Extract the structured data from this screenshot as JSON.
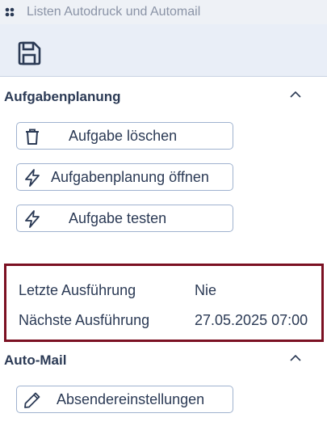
{
  "window": {
    "title": "Listen Autodruck und Automail"
  },
  "toolbar": {
    "save_icon": "floppy-disk-icon"
  },
  "task_planning": {
    "title": "Aufgabenplanung",
    "buttons": [
      {
        "label": "Aufgabe löschen",
        "icon": "trash-icon"
      },
      {
        "label": "Aufgabenplanung öffnen",
        "icon": "lightning-icon"
      },
      {
        "label": "Aufgabe testen",
        "icon": "lightning-icon"
      }
    ]
  },
  "execution_info": {
    "last_label": "Letzte Ausführung",
    "last_value": "Nie",
    "next_label": "Nächste Ausführung",
    "next_value": "27.05.2025 07:00"
  },
  "auto_mail": {
    "title": "Auto-Mail",
    "buttons": [
      {
        "label": "Absendereinstellungen",
        "icon": "pencil-icon"
      }
    ]
  },
  "colors": {
    "accent": "#2b3a55",
    "highlight_border": "#7b1022",
    "button_border": "#9fb2cf",
    "toolbar_bg": "#e9eef7"
  }
}
